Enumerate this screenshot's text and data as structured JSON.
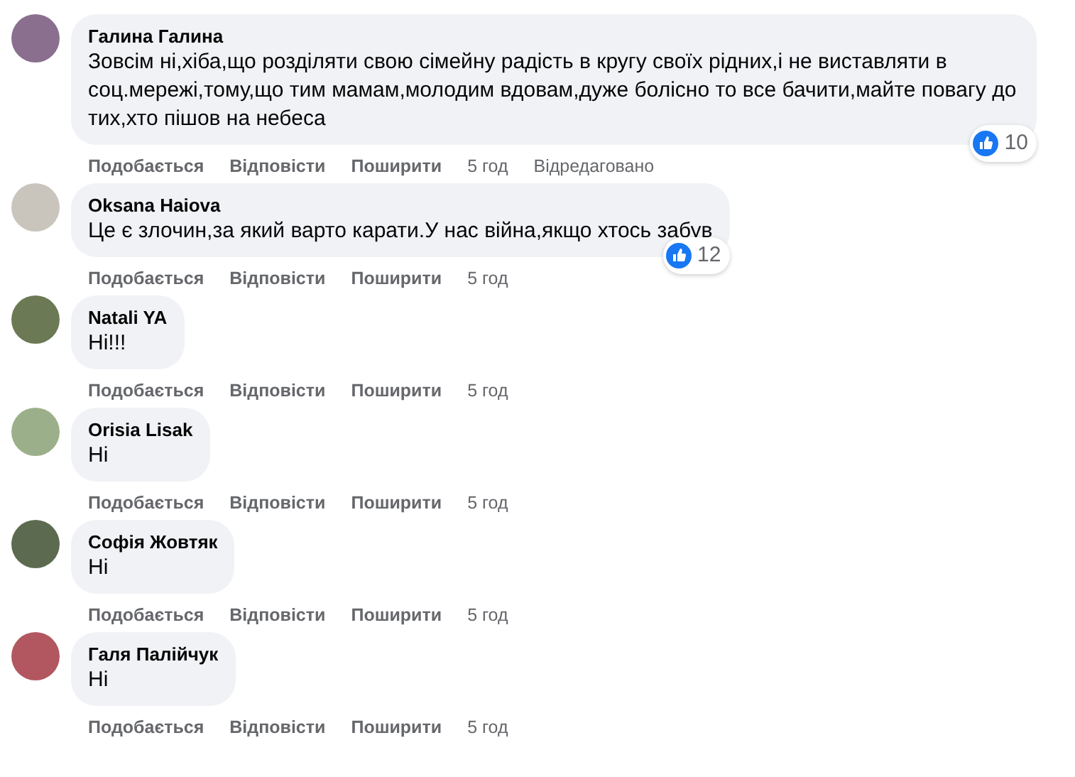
{
  "comments": [
    {
      "author": "Галина Галина",
      "text": "Зовсім ні,хіба,що розділяти свою сімейну радість в кругу своїх рідних,і не виставляти в соц.мережі,тому,що тим мамам,молодим вдовам,дуже болісно то все бачити,майте повагу до тих,хто пішов на небеса",
      "reactions": "10",
      "like": "Подобається",
      "reply": "Відповісти",
      "share": "Поширити",
      "time": "5 год",
      "edited": "Відредаговано"
    },
    {
      "author": "Oksana Haiova",
      "text": "Це є злочин,за який варто карати.У нас війна,якщо хтось забув",
      "reactions": "12",
      "like": "Подобається",
      "reply": "Відповісти",
      "share": "Поширити",
      "time": "5 год"
    },
    {
      "author": "Natali YA",
      "text": "Ні!!!",
      "like": "Подобається",
      "reply": "Відповісти",
      "share": "Поширити",
      "time": "5 год"
    },
    {
      "author": "Orisia Lisak",
      "text": "Ні",
      "like": "Подобається",
      "reply": "Відповісти",
      "share": "Поширити",
      "time": "5 год"
    },
    {
      "author": "Софія Жовтяк",
      "text": "Ні",
      "like": "Подобається",
      "reply": "Відповісти",
      "share": "Поширити",
      "time": "5 год"
    },
    {
      "author": "Галя Палійчук",
      "text": "Ні",
      "like": "Подобається",
      "reply": "Відповісти",
      "share": "Поширити",
      "time": "5 год"
    }
  ]
}
